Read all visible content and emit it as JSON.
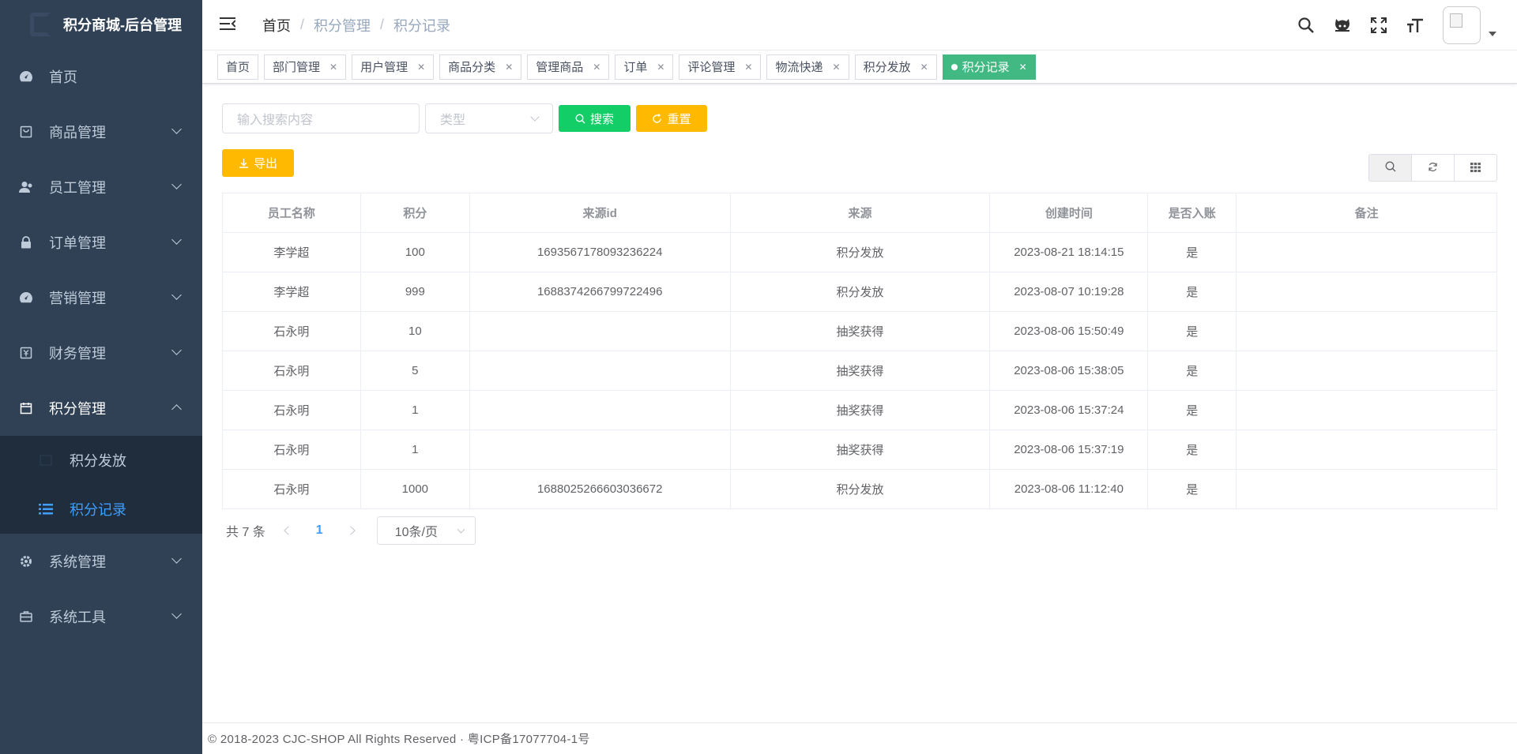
{
  "app": {
    "title": "积分商城-后台管理"
  },
  "sidebar": {
    "items": [
      {
        "label": "首页",
        "icon": "dashboard-icon"
      },
      {
        "label": "商品管理",
        "icon": "shopping-icon"
      },
      {
        "label": "员工管理",
        "icon": "user-icon"
      },
      {
        "label": "订单管理",
        "icon": "lock-icon"
      },
      {
        "label": "营销管理",
        "icon": "dashboard-icon"
      },
      {
        "label": "财务管理",
        "icon": "money-icon"
      },
      {
        "label": "积分管理",
        "icon": "calendar-icon"
      },
      {
        "label": "系统管理",
        "icon": "gear-icon"
      },
      {
        "label": "系统工具",
        "icon": "toolbox-icon"
      }
    ],
    "sub_items": [
      {
        "label": "积分发放"
      },
      {
        "label": "积分记录"
      }
    ]
  },
  "breadcrumb": {
    "home": "首页",
    "section": "积分管理",
    "current": "积分记录",
    "separator": "/"
  },
  "tags": [
    {
      "label": "首页"
    },
    {
      "label": "部门管理"
    },
    {
      "label": "用户管理"
    },
    {
      "label": "商品分类"
    },
    {
      "label": "管理商品"
    },
    {
      "label": "订单"
    },
    {
      "label": "评论管理"
    },
    {
      "label": "物流快递"
    },
    {
      "label": "积分发放"
    },
    {
      "label": "积分记录"
    }
  ],
  "search": {
    "placeholder": "输入搜索内容",
    "type_placeholder": "类型",
    "search_label": "搜索",
    "reset_label": "重置",
    "export_label": "导出"
  },
  "table": {
    "headers": [
      "员工名称",
      "积分",
      "来源id",
      "来源",
      "创建时间",
      "是否入账",
      "备注"
    ],
    "rows": [
      [
        "李学超",
        "100",
        "1693567178093236224",
        "积分发放",
        "2023-08-21 18:14:15",
        "是",
        ""
      ],
      [
        "李学超",
        "999",
        "1688374266799722496",
        "积分发放",
        "2023-08-07 10:19:28",
        "是",
        ""
      ],
      [
        "石永明",
        "10",
        "",
        "抽奖获得",
        "2023-08-06 15:50:49",
        "是",
        ""
      ],
      [
        "石永明",
        "5",
        "",
        "抽奖获得",
        "2023-08-06 15:38:05",
        "是",
        ""
      ],
      [
        "石永明",
        "1",
        "",
        "抽奖获得",
        "2023-08-06 15:37:24",
        "是",
        ""
      ],
      [
        "石永明",
        "1",
        "",
        "抽奖获得",
        "2023-08-06 15:37:19",
        "是",
        ""
      ],
      [
        "石永明",
        "1000",
        "1688025266603036672",
        "积分发放",
        "2023-08-06 11:12:40",
        "是",
        ""
      ]
    ]
  },
  "pagination": {
    "total": "共 7 条",
    "page": "1",
    "page_size": "10条/页"
  },
  "footer": {
    "text": "© 2018-2023 CJC-SHOP All Rights Reserved · 粤ICP备17077704-1号"
  },
  "colors": {
    "sidebar_bg": "#304156",
    "submenu_bg": "#1f2d3d",
    "active": "#409eff",
    "tag_active": "#42b983",
    "success": "#13ce66",
    "warning": "#ffba00"
  }
}
